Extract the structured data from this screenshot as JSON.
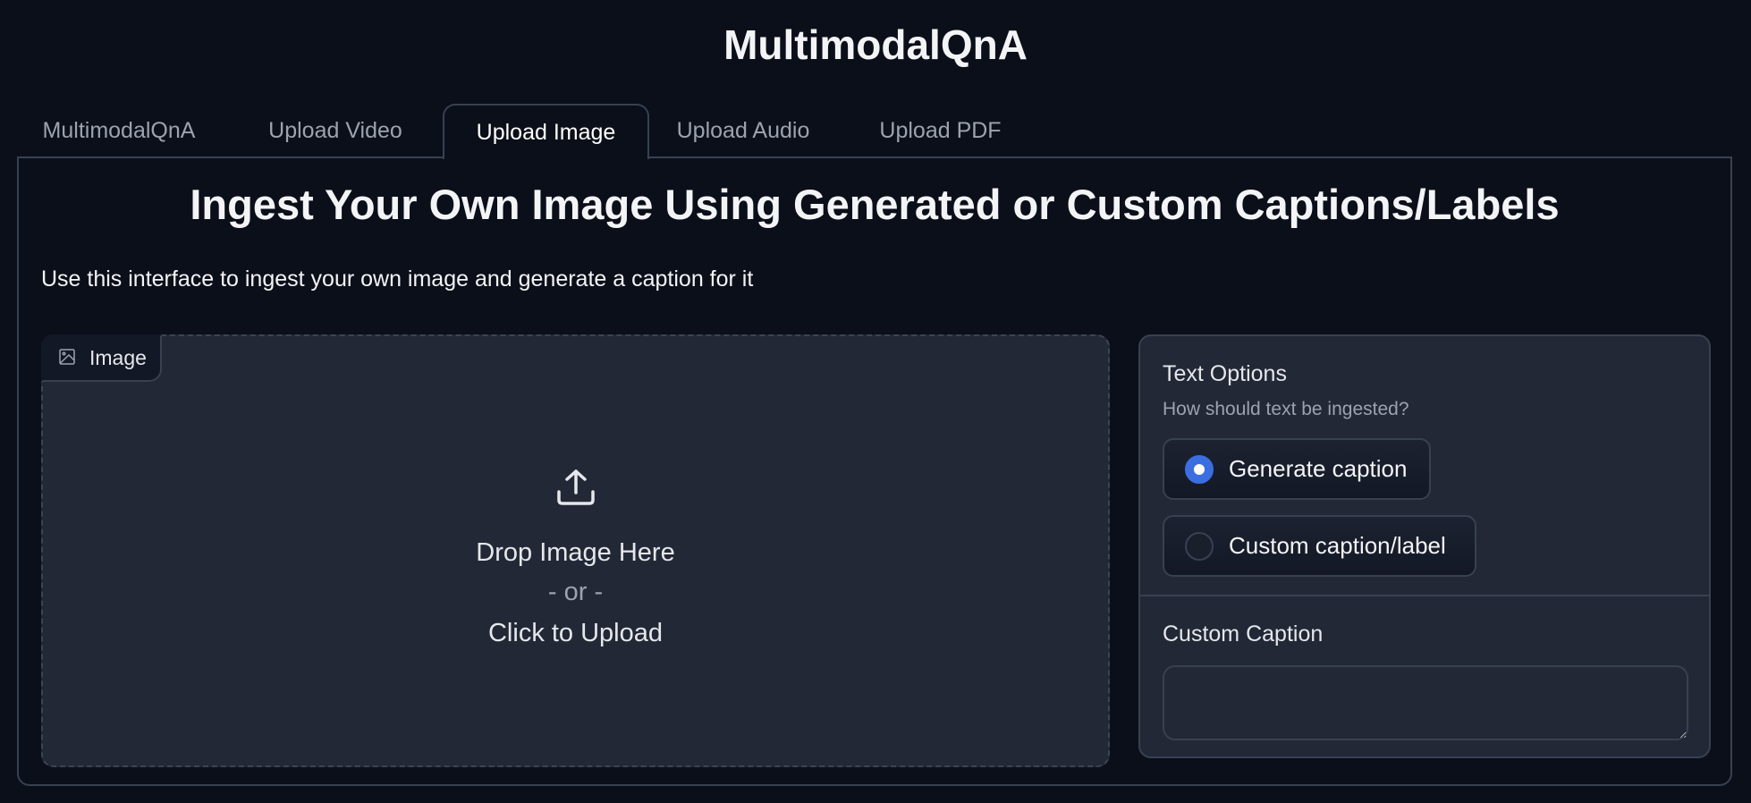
{
  "app": {
    "title": "MultimodalQnA"
  },
  "tabs": [
    {
      "label": "MultimodalQnA",
      "active": false
    },
    {
      "label": "Upload Video",
      "active": false
    },
    {
      "label": "Upload Image",
      "active": true
    },
    {
      "label": "Upload Audio",
      "active": false
    },
    {
      "label": "Upload PDF",
      "active": false
    }
  ],
  "main": {
    "heading": "Ingest Your Own Image Using Generated or Custom Captions/Labels",
    "description": "Use this interface to ingest your own image and generate a caption for it",
    "image_upload": {
      "label": "Image",
      "label_icon": "image-icon",
      "upload_icon": "upload-icon",
      "drop_text": "Drop Image Here",
      "or_text": "- or -",
      "click_text": "Click to Upload"
    },
    "text_options": {
      "title": "Text Options",
      "info": "How should text be ingested?",
      "options": [
        {
          "label": "Generate caption",
          "selected": true
        },
        {
          "label": "Custom caption/label",
          "selected": false
        }
      ]
    },
    "custom_caption": {
      "label": "Custom Caption",
      "value": "",
      "placeholder": ""
    }
  },
  "colors": {
    "background": "#0b0f19",
    "panel": "#222836",
    "border": "#374151",
    "accent": "#3b6ee0"
  }
}
